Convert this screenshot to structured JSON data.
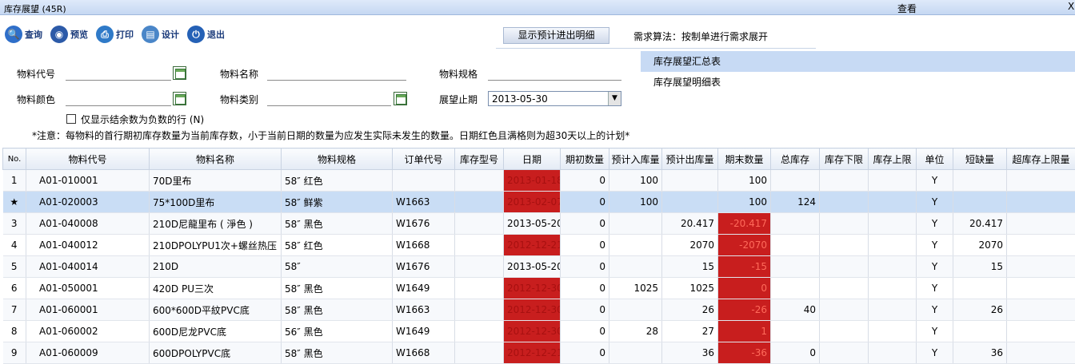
{
  "window": {
    "title": "库存展望 (45R)",
    "center": "查看",
    "close": "X"
  },
  "toolbar": [
    {
      "label": "查询",
      "icon": "search-icon",
      "color": "#2f6fc9",
      "glyph": "🔍"
    },
    {
      "label": "预览",
      "icon": "preview-icon",
      "color": "#2c5aa8",
      "glyph": "◉"
    },
    {
      "label": "打印",
      "icon": "print-icon",
      "color": "#2f7ac8",
      "glyph": "⎙"
    },
    {
      "label": "设计",
      "icon": "design-icon",
      "color": "#4a86c8",
      "glyph": "▤"
    },
    {
      "label": "退出",
      "icon": "exit-icon",
      "color": "#2561b6",
      "glyph": "⏻"
    }
  ],
  "show_detail_button": "显示预计进出明细",
  "algorithm_text": "需求算法：按制单进行需求展开",
  "filters": {
    "material_code_label": "物料代号",
    "material_code_value": "",
    "material_name_label": "物料名称",
    "material_name_value": "",
    "material_spec_label": "物料规格",
    "material_spec_value": "",
    "material_color_label": "物料颜色",
    "material_color_value": "",
    "material_type_label": "物料类别",
    "material_type_value": "",
    "horizon_label": "展望止期",
    "horizon_value": "2013-05-30"
  },
  "negative_only_label": "仅显示结余数为负数的行 (N)",
  "note": "*注意：每物料的首行期初库存数量为当前库存数，小于当前日期的数量为应发生实际未发生的数量。日期红色且满格则为超30天以上的计划*",
  "side_nav": [
    "库存展望汇总表",
    "库存展望明细表"
  ],
  "columns": [
    "No.",
    "物料代号",
    "物料名称",
    "物料规格",
    "订单代号",
    "库存型号",
    "日期",
    "期初数量",
    "预计入库量",
    "预计出库量",
    "期末数量",
    "总库存",
    "库存下限",
    "库存上限",
    "单位",
    "短缺量",
    "超库存上限量"
  ],
  "rows": [
    {
      "no": "1",
      "code": "A01-010001",
      "name": "70D里布",
      "spec": "58″ 红色",
      "order": "",
      "model": "",
      "date": "2013-01-18",
      "date_red": true,
      "begin": "0",
      "in": "100",
      "out": "",
      "end": "100",
      "end_red": false,
      "total": "",
      "low": "",
      "high": "",
      "unit": "Y",
      "short": "",
      "over": ""
    },
    {
      "no": "★",
      "code": "A01-020003",
      "name": "75*100D里布",
      "spec": "58″ 鲜紫",
      "order": "W1663",
      "model": "",
      "date": "2013-02-07",
      "date_red": true,
      "begin": "0",
      "in": "100",
      "out": "",
      "end": "100",
      "end_red": false,
      "total": "124",
      "low": "",
      "high": "",
      "unit": "Y",
      "short": "",
      "over": ""
    },
    {
      "no": "3",
      "code": "A01-040008",
      "name": "210D尼龍里布 ( 淨色 )",
      "spec": "58″ 黑色",
      "order": "W1676",
      "model": "",
      "date": "2013-05-20",
      "date_red": false,
      "begin": "0",
      "in": "",
      "out": "20.417",
      "end": "-20.417",
      "end_red": true,
      "total": "",
      "low": "",
      "high": "",
      "unit": "Y",
      "short": "20.417",
      "over": ""
    },
    {
      "no": "4",
      "code": "A01-040012",
      "name": "210DPOLYPU1次+螺丝热压",
      "spec": "58″ 红色",
      "order": "W1668",
      "model": "",
      "date": "2012-12-21",
      "date_red": true,
      "begin": "0",
      "in": "",
      "out": "2070",
      "end": "-2070",
      "end_red": true,
      "total": "",
      "low": "",
      "high": "",
      "unit": "Y",
      "short": "2070",
      "over": ""
    },
    {
      "no": "5",
      "code": "A01-040014",
      "name": "210D",
      "spec": "58″",
      "order": "W1676",
      "model": "",
      "date": "2013-05-20",
      "date_red": false,
      "begin": "0",
      "in": "",
      "out": "15",
      "end": "-15",
      "end_red": true,
      "total": "",
      "low": "",
      "high": "",
      "unit": "Y",
      "short": "15",
      "over": ""
    },
    {
      "no": "6",
      "code": "A01-050001",
      "name": "420D PU三次",
      "spec": "58″ 黑色",
      "order": "W1649",
      "model": "",
      "date": "2012-12-30",
      "date_red": true,
      "begin": "0",
      "in": "1025",
      "out": "1025",
      "end": "0",
      "end_red": true,
      "total": "",
      "low": "",
      "high": "",
      "unit": "Y",
      "short": "",
      "over": ""
    },
    {
      "no": "7",
      "code": "A01-060001",
      "name": "600*600D平紋PVC底",
      "spec": "58″ 黑色",
      "order": "W1663",
      "model": "",
      "date": "2012-12-30",
      "date_red": true,
      "begin": "0",
      "in": "",
      "out": "26",
      "end": "-26",
      "end_red": true,
      "total": "40",
      "low": "",
      "high": "",
      "unit": "Y",
      "short": "26",
      "over": ""
    },
    {
      "no": "8",
      "code": "A01-060002",
      "name": "600D尼龙PVC底",
      "spec": "56″ 黑色",
      "order": "W1649",
      "model": "",
      "date": "2012-12-30",
      "date_red": true,
      "begin": "0",
      "in": "28",
      "out": "27",
      "end": "1",
      "end_red": true,
      "total": "",
      "low": "",
      "high": "",
      "unit": "Y",
      "short": "",
      "over": ""
    },
    {
      "no": "9",
      "code": "A01-060009",
      "name": "600DPOLYPVC底",
      "spec": "58″ 黑色",
      "order": "W1668",
      "model": "",
      "date": "2012-12-21",
      "date_red": true,
      "begin": "0",
      "in": "",
      "out": "36",
      "end": "-36",
      "end_red": true,
      "total": "0",
      "low": "",
      "high": "",
      "unit": "Y",
      "short": "36",
      "over": ""
    }
  ]
}
